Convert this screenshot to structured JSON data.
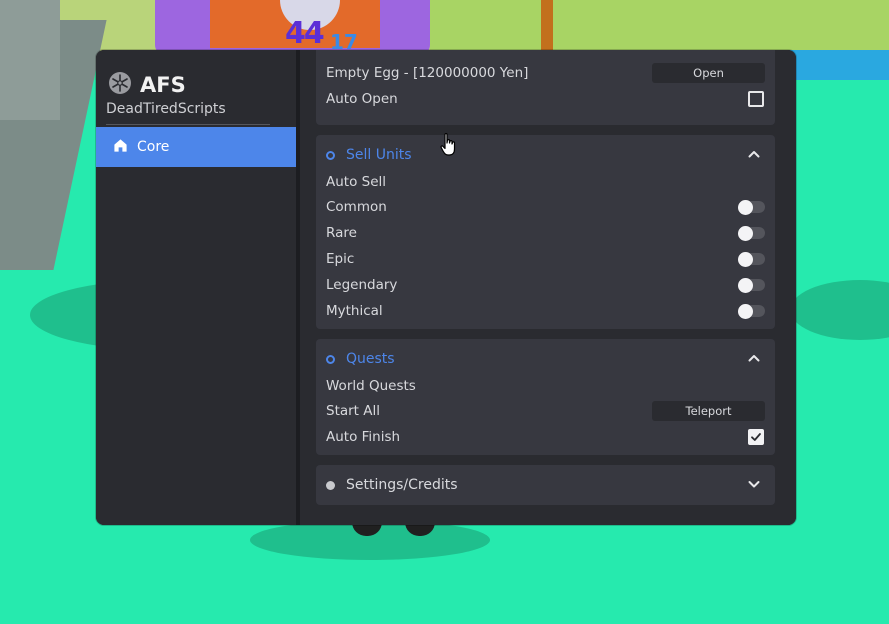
{
  "scene": {
    "character_level": "44",
    "character_sublevel": "17"
  },
  "sidebar": {
    "logo_icon": "snowflake-icon",
    "title": "AFS",
    "subtitle": "DeadTiredScripts",
    "items": [
      {
        "icon": "home-icon",
        "label": "Core",
        "active": true
      }
    ]
  },
  "egg_section": {
    "rows": [
      {
        "label": "Empty Egg - [120000000 Yen]",
        "button": "Open"
      },
      {
        "label": "Auto Open",
        "checked": false
      }
    ]
  },
  "sell_units": {
    "title": "Sell Units",
    "expanded": true,
    "rows": [
      {
        "label": "Auto Sell"
      },
      {
        "label": "Common",
        "on": false
      },
      {
        "label": "Rare",
        "on": false
      },
      {
        "label": "Epic",
        "on": false
      },
      {
        "label": "Legendary",
        "on": false
      },
      {
        "label": "Mythical",
        "on": false
      }
    ]
  },
  "quests": {
    "title": "Quests",
    "expanded": true,
    "rows": [
      {
        "label": "World Quests"
      },
      {
        "label": "Start All",
        "button": "Teleport"
      },
      {
        "label": "Auto Finish",
        "checked": true
      }
    ]
  },
  "settings": {
    "title": "Settings/Credits",
    "expanded": false
  },
  "colors": {
    "accent": "#4d86ea",
    "panel": "#2a2b30",
    "section": "#373840",
    "text": "#d8d9dd"
  }
}
